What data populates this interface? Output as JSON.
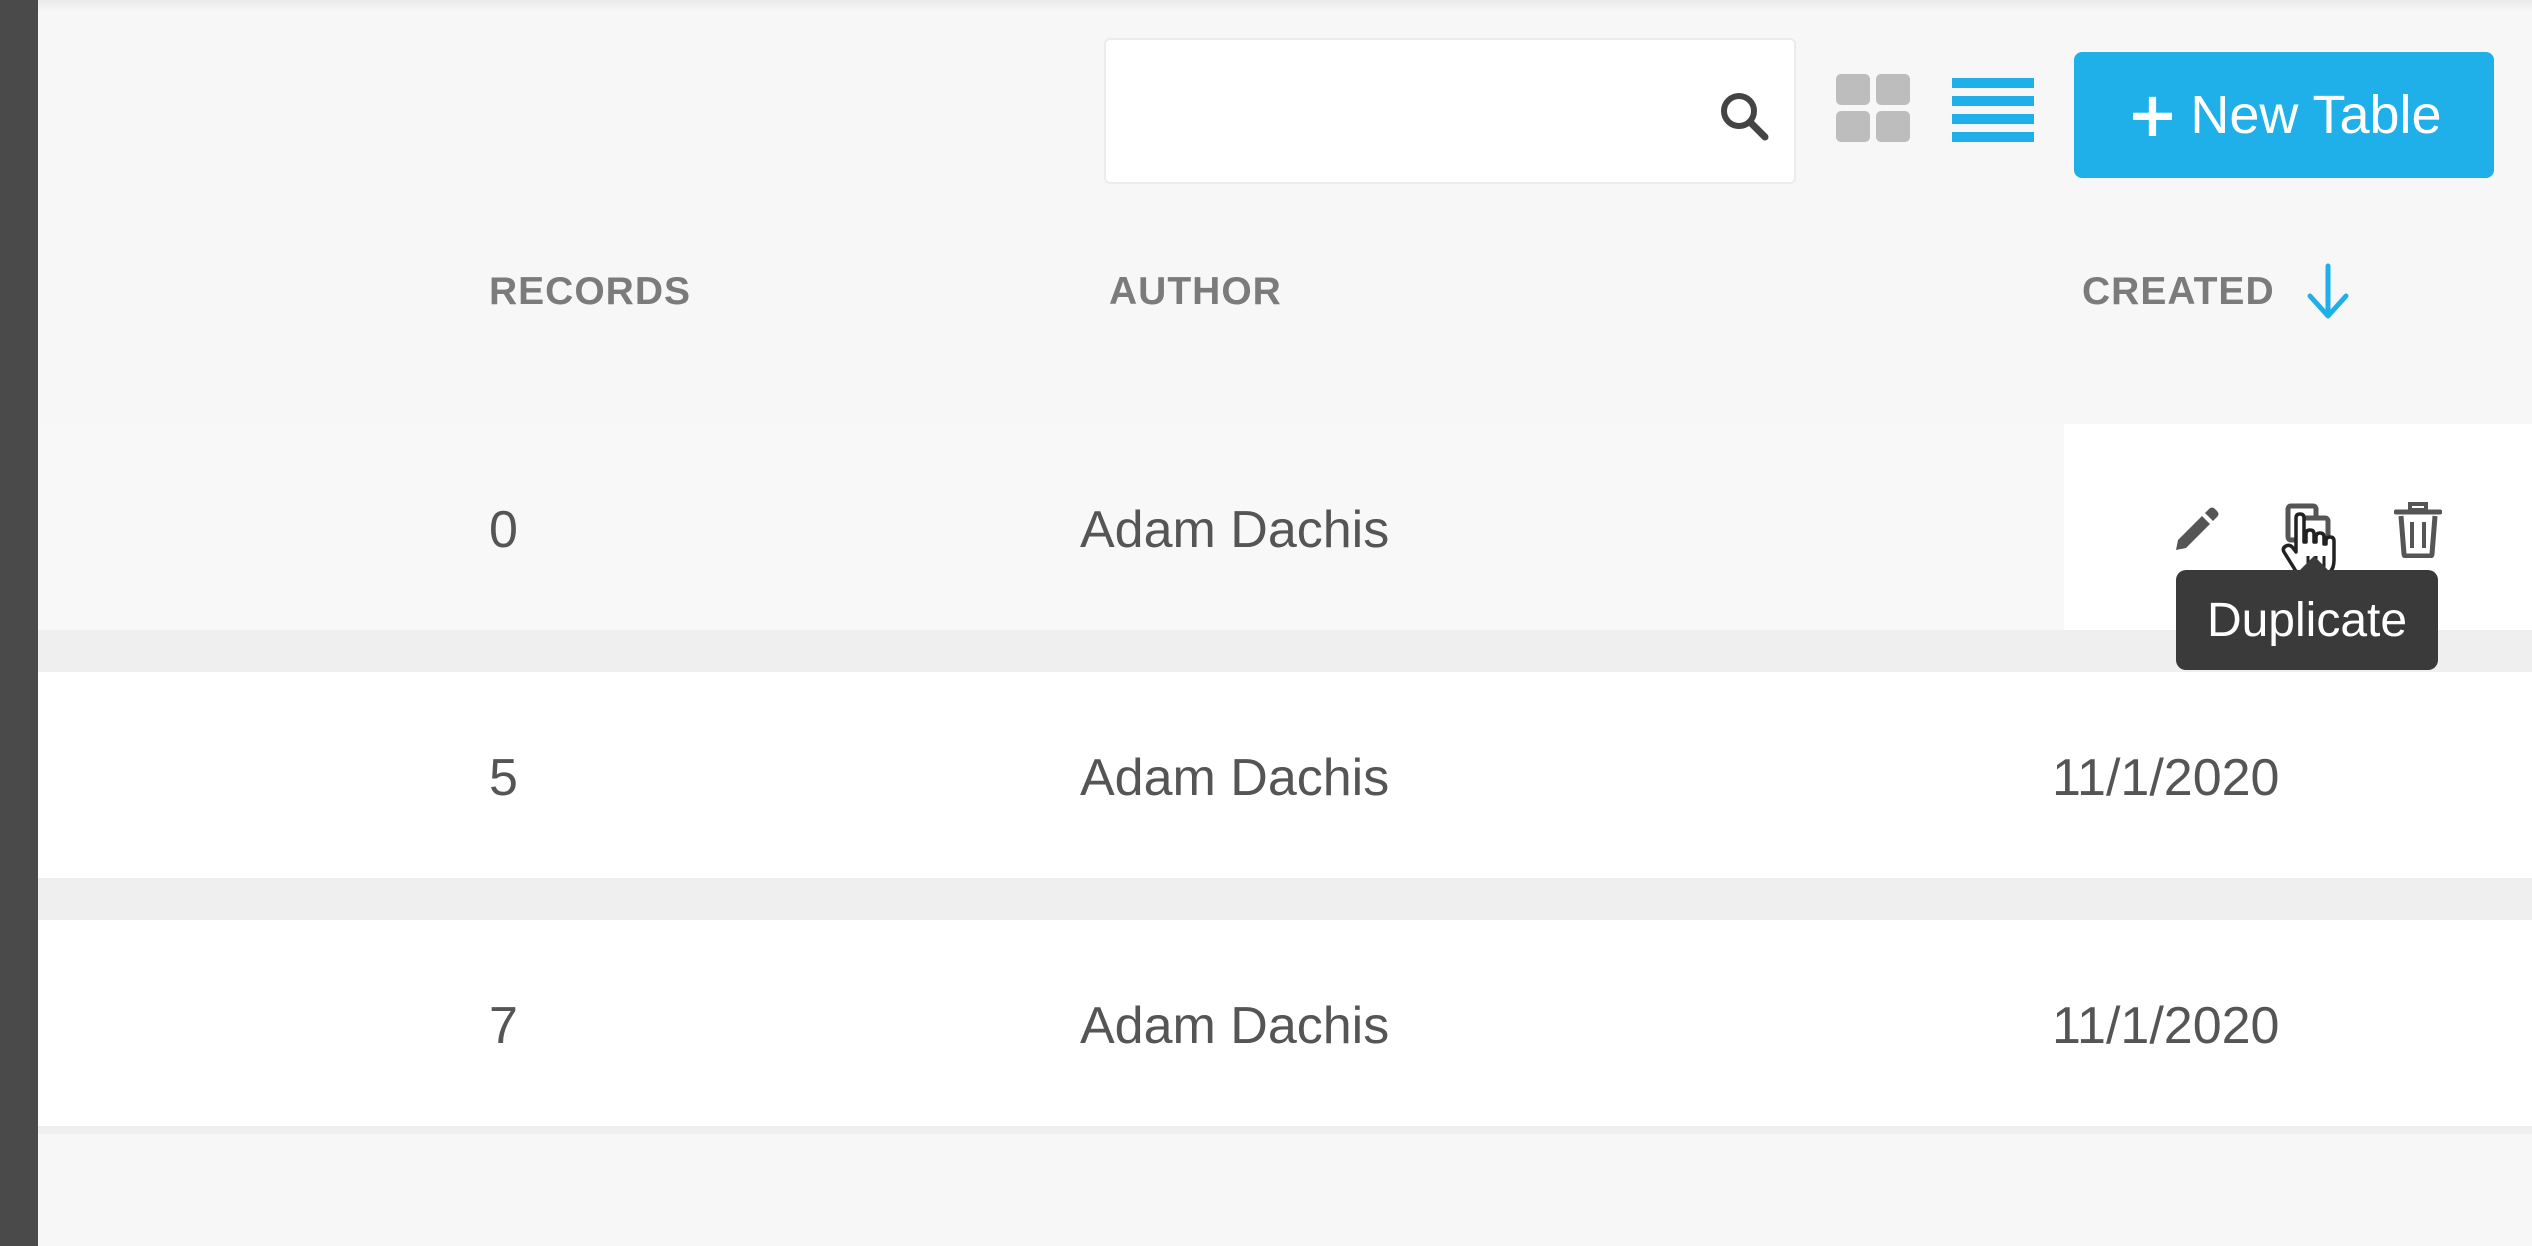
{
  "toolbar": {
    "search_value": "",
    "search_icon": "search-icon",
    "grid_view_icon": "grid-view-icon",
    "list_view_icon": "list-view-icon",
    "new_table_label": "New Table",
    "new_table_icon": "plus-icon",
    "plus_glyph": "+",
    "accent_color": "#1fb0ea"
  },
  "table": {
    "columns": [
      "RECORDS",
      "AUTHOR",
      "CREATED"
    ],
    "sort_column": "CREATED",
    "sort_direction": "descending",
    "rows": [
      {
        "records": "0",
        "author": "Adam Dachis",
        "created": ""
      },
      {
        "records": "5",
        "author": "Adam Dachis",
        "created": "11/1/2020"
      },
      {
        "records": "7",
        "author": "Adam Dachis",
        "created": "11/1/2020"
      }
    ]
  },
  "row_actions": {
    "icons": [
      "edit-icon",
      "duplicate-icon",
      "delete-icon"
    ],
    "tooltip": "Duplicate"
  }
}
